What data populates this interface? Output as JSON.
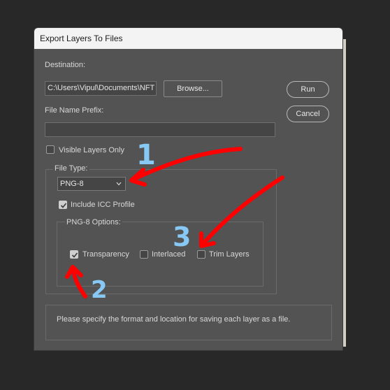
{
  "dialog": {
    "title": "Export Layers To Files",
    "destination_label": "Destination:",
    "destination_value": "C:\\Users\\Vipul\\Documents\\NFT s",
    "browse_label": "Browse...",
    "run_label": "Run",
    "cancel_label": "Cancel",
    "prefix_label": "File Name Prefix:",
    "prefix_value": "",
    "visible_only_label": "Visible Layers Only",
    "visible_only_checked": false,
    "file_type_label": "File Type:",
    "file_type_value": "PNG-8",
    "include_icc_label": "Include ICC Profile",
    "include_icc_checked": true,
    "png8_options_label": "PNG-8 Options:",
    "transparency_label": "Transparency",
    "transparency_checked": true,
    "interlaced_label": "Interlaced",
    "interlaced_checked": false,
    "trim_layers_label": "Trim Layers",
    "trim_layers_checked": false,
    "status_text": "Please specify the format and location for saving each layer as a file."
  },
  "annotations": {
    "numbers": [
      "1",
      "2",
      "3"
    ],
    "arrow_color": "#ff0000",
    "number_color": "#87c8f5"
  }
}
